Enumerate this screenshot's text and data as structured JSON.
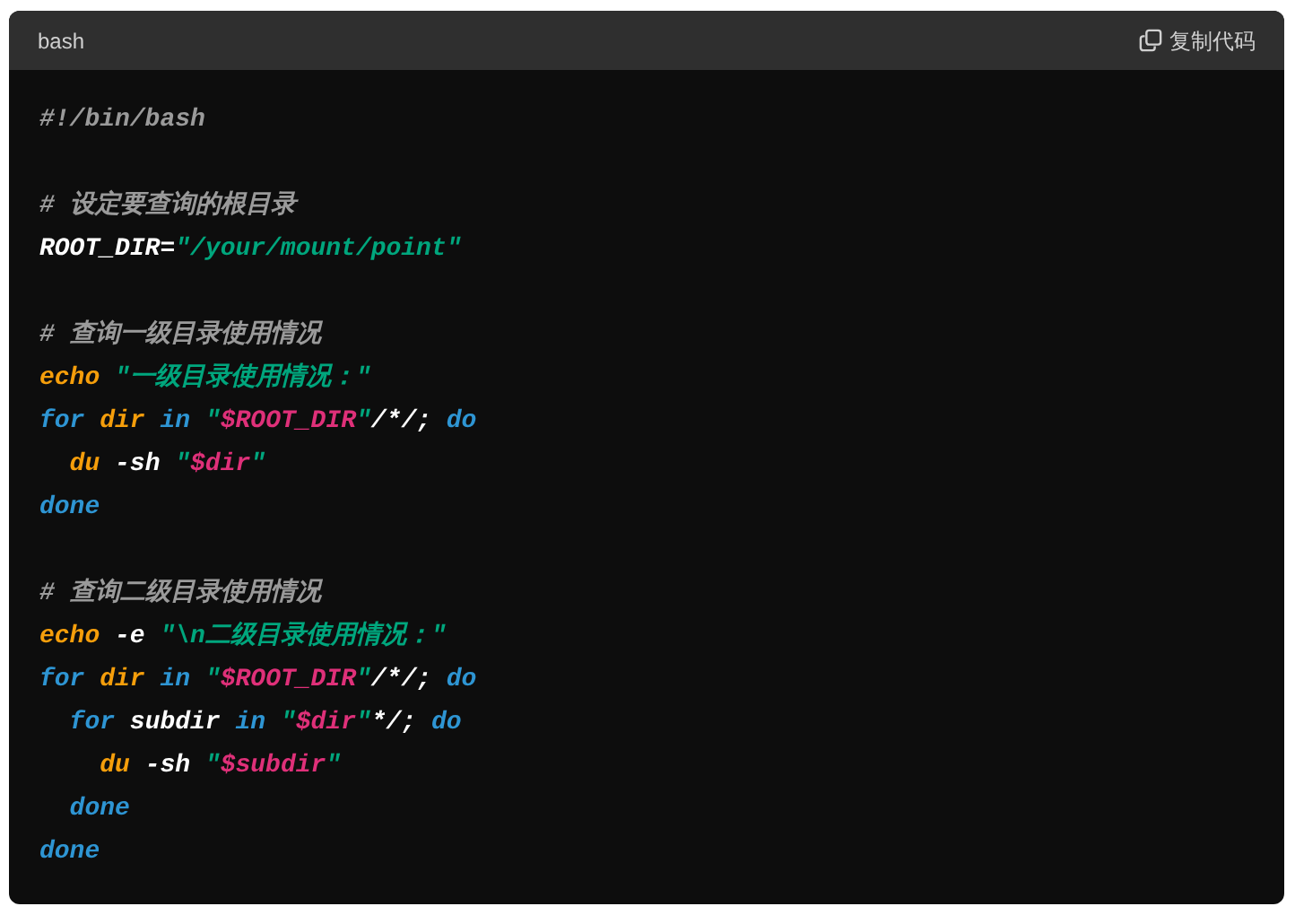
{
  "code_block": {
    "language": "bash",
    "copy_button": "复制代码",
    "lines": [
      {
        "kind": "code",
        "tokens": [
          {
            "kind": "comment",
            "text": "#!/bin/bash"
          }
        ]
      },
      {
        "kind": "blank"
      },
      {
        "kind": "code",
        "tokens": [
          {
            "kind": "comment",
            "text": "# 设定要查询的根目录"
          }
        ]
      },
      {
        "kind": "code",
        "tokens": [
          {
            "kind": "plain",
            "text": "ROOT_DIR="
          },
          {
            "kind": "string",
            "text": "\"/your/mount/point\""
          }
        ]
      },
      {
        "kind": "blank"
      },
      {
        "kind": "code",
        "tokens": [
          {
            "kind": "comment",
            "text": "# 查询一级目录使用情况"
          }
        ]
      },
      {
        "kind": "code",
        "tokens": [
          {
            "kind": "builtin",
            "text": "echo"
          },
          {
            "kind": "string",
            "text": " \"一级目录使用情况：\""
          }
        ]
      },
      {
        "kind": "code",
        "tokens": [
          {
            "kind": "keyword",
            "text": "for"
          },
          {
            "kind": "builtin",
            "text": " dir"
          },
          {
            "kind": "keyword",
            "text": " in"
          },
          {
            "kind": "string",
            "text": " \""
          },
          {
            "kind": "variable",
            "text": "$ROOT_DIR"
          },
          {
            "kind": "string",
            "text": "\""
          },
          {
            "kind": "plain",
            "text": "/*/;"
          },
          {
            "kind": "keyword",
            "text": " do"
          }
        ]
      },
      {
        "kind": "code",
        "tokens": [
          {
            "kind": "builtin",
            "text": "  du"
          },
          {
            "kind": "plain",
            "text": " -sh"
          },
          {
            "kind": "string",
            "text": " \""
          },
          {
            "kind": "variable",
            "text": "$dir"
          },
          {
            "kind": "string",
            "text": "\""
          }
        ]
      },
      {
        "kind": "code",
        "tokens": [
          {
            "kind": "keyword",
            "text": "done"
          }
        ]
      },
      {
        "kind": "blank"
      },
      {
        "kind": "code",
        "tokens": [
          {
            "kind": "comment",
            "text": "# 查询二级目录使用情况"
          }
        ]
      },
      {
        "kind": "code",
        "tokens": [
          {
            "kind": "builtin",
            "text": "echo"
          },
          {
            "kind": "plain",
            "text": " -e "
          },
          {
            "kind": "string",
            "text": "\"\\n二级目录使用情况：\""
          }
        ]
      },
      {
        "kind": "code",
        "tokens": [
          {
            "kind": "keyword",
            "text": "for"
          },
          {
            "kind": "builtin",
            "text": " dir"
          },
          {
            "kind": "keyword",
            "text": " in"
          },
          {
            "kind": "string",
            "text": " \""
          },
          {
            "kind": "variable",
            "text": "$ROOT_DIR"
          },
          {
            "kind": "string",
            "text": "\""
          },
          {
            "kind": "plain",
            "text": "/*/;"
          },
          {
            "kind": "keyword",
            "text": " do"
          }
        ]
      },
      {
        "kind": "code",
        "tokens": [
          {
            "kind": "keyword",
            "text": "  for"
          },
          {
            "kind": "plain",
            "text": " subdir"
          },
          {
            "kind": "keyword",
            "text": " in"
          },
          {
            "kind": "string",
            "text": " \""
          },
          {
            "kind": "variable",
            "text": "$dir"
          },
          {
            "kind": "string",
            "text": "\""
          },
          {
            "kind": "plain",
            "text": "*/;"
          },
          {
            "kind": "keyword",
            "text": " do"
          }
        ]
      },
      {
        "kind": "code",
        "tokens": [
          {
            "kind": "builtin",
            "text": "    du"
          },
          {
            "kind": "plain",
            "text": " -sh"
          },
          {
            "kind": "string",
            "text": " \""
          },
          {
            "kind": "variable",
            "text": "$subdir"
          },
          {
            "kind": "string",
            "text": "\""
          }
        ]
      },
      {
        "kind": "code",
        "tokens": [
          {
            "kind": "keyword",
            "text": "  done"
          }
        ]
      },
      {
        "kind": "code",
        "tokens": [
          {
            "kind": "keyword",
            "text": "done"
          }
        ]
      }
    ]
  }
}
